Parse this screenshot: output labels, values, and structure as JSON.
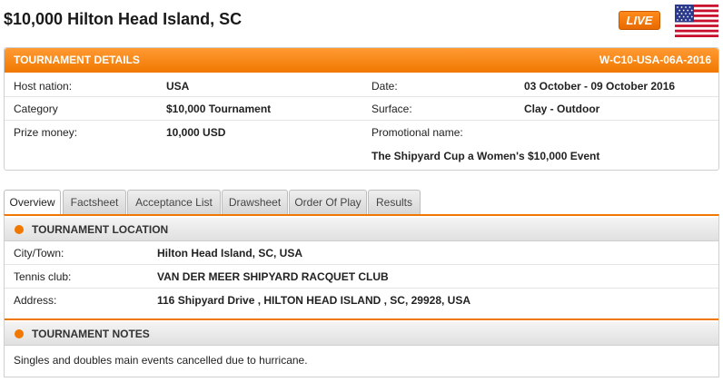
{
  "header": {
    "title": "$10,000 Hilton Head Island, SC",
    "live_label": "LIVE",
    "flag_icon": "usa-flag-icon"
  },
  "details": {
    "heading": "TOURNAMENT DETAILS",
    "code": "W-C10-USA-06A-2016",
    "host_nation_label": "Host nation:",
    "host_nation": "USA",
    "category_label": "Category",
    "category": "$10,000 Tournament",
    "prize_label": "Prize money:",
    "prize": "10,000 USD",
    "date_label": "Date:",
    "date": "03 October - 09 October 2016",
    "surface_label": "Surface:",
    "surface": "Clay - Outdoor",
    "promo_label": "Promotional name:",
    "promo": "The Shipyard Cup a Women's $10,000 Event"
  },
  "tabs": [
    {
      "label": "Overview"
    },
    {
      "label": "Factsheet"
    },
    {
      "label": "Acceptance List"
    },
    {
      "label": "Drawsheet"
    },
    {
      "label": "Order Of Play"
    },
    {
      "label": "Results"
    }
  ],
  "location": {
    "heading": "TOURNAMENT LOCATION",
    "city_label": "City/Town:",
    "city": "Hilton Head Island, SC, USA",
    "club_label": "Tennis club:",
    "club": "VAN DER MEER SHIPYARD RACQUET CLUB",
    "address_label": "Address:",
    "address": "116 Shipyard Drive , HILTON HEAD ISLAND , SC, 29928, USA"
  },
  "notes": {
    "heading": "TOURNAMENT NOTES",
    "text": "Singles and doubles main events cancelled due to hurricane."
  },
  "colors": {
    "accent": "#f07800"
  }
}
